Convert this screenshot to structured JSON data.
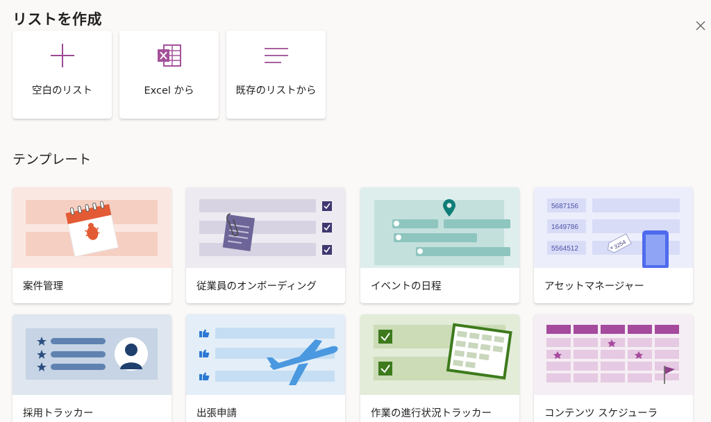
{
  "dialog": {
    "title": "リストを作成",
    "close_icon": "close-icon"
  },
  "create_options": [
    {
      "label": "空白のリスト",
      "icon": "plus-icon"
    },
    {
      "label": "Excel から",
      "icon": "excel-icon"
    },
    {
      "label": "既存のリストから",
      "icon": "list-lines-icon"
    }
  ],
  "templates_heading": "テンプレート",
  "templates": [
    {
      "name": "案件管理",
      "bg": "#fbe7e1"
    },
    {
      "name": "従業員のオンボーディング",
      "bg": "#edebf1"
    },
    {
      "name": "イベントの日程",
      "bg": "#deeeec"
    },
    {
      "name": "アセットマネージャー",
      "bg": "#eceefb",
      "ids": [
        "5687156",
        "1649786",
        "5564512"
      ],
      "tag": "3254"
    },
    {
      "name": "採用トラッカー",
      "bg": "#dfe6ef"
    },
    {
      "name": "出張申請",
      "bg": "#e3eef8"
    },
    {
      "name": "作業の進行状況トラッカー",
      "bg": "#e3ecd8"
    },
    {
      "name": "コンテンツ スケジューラ",
      "bg": "#f5eef4"
    }
  ],
  "colors": {
    "accent": "#8f4b9b",
    "excel": "#a4509a"
  }
}
